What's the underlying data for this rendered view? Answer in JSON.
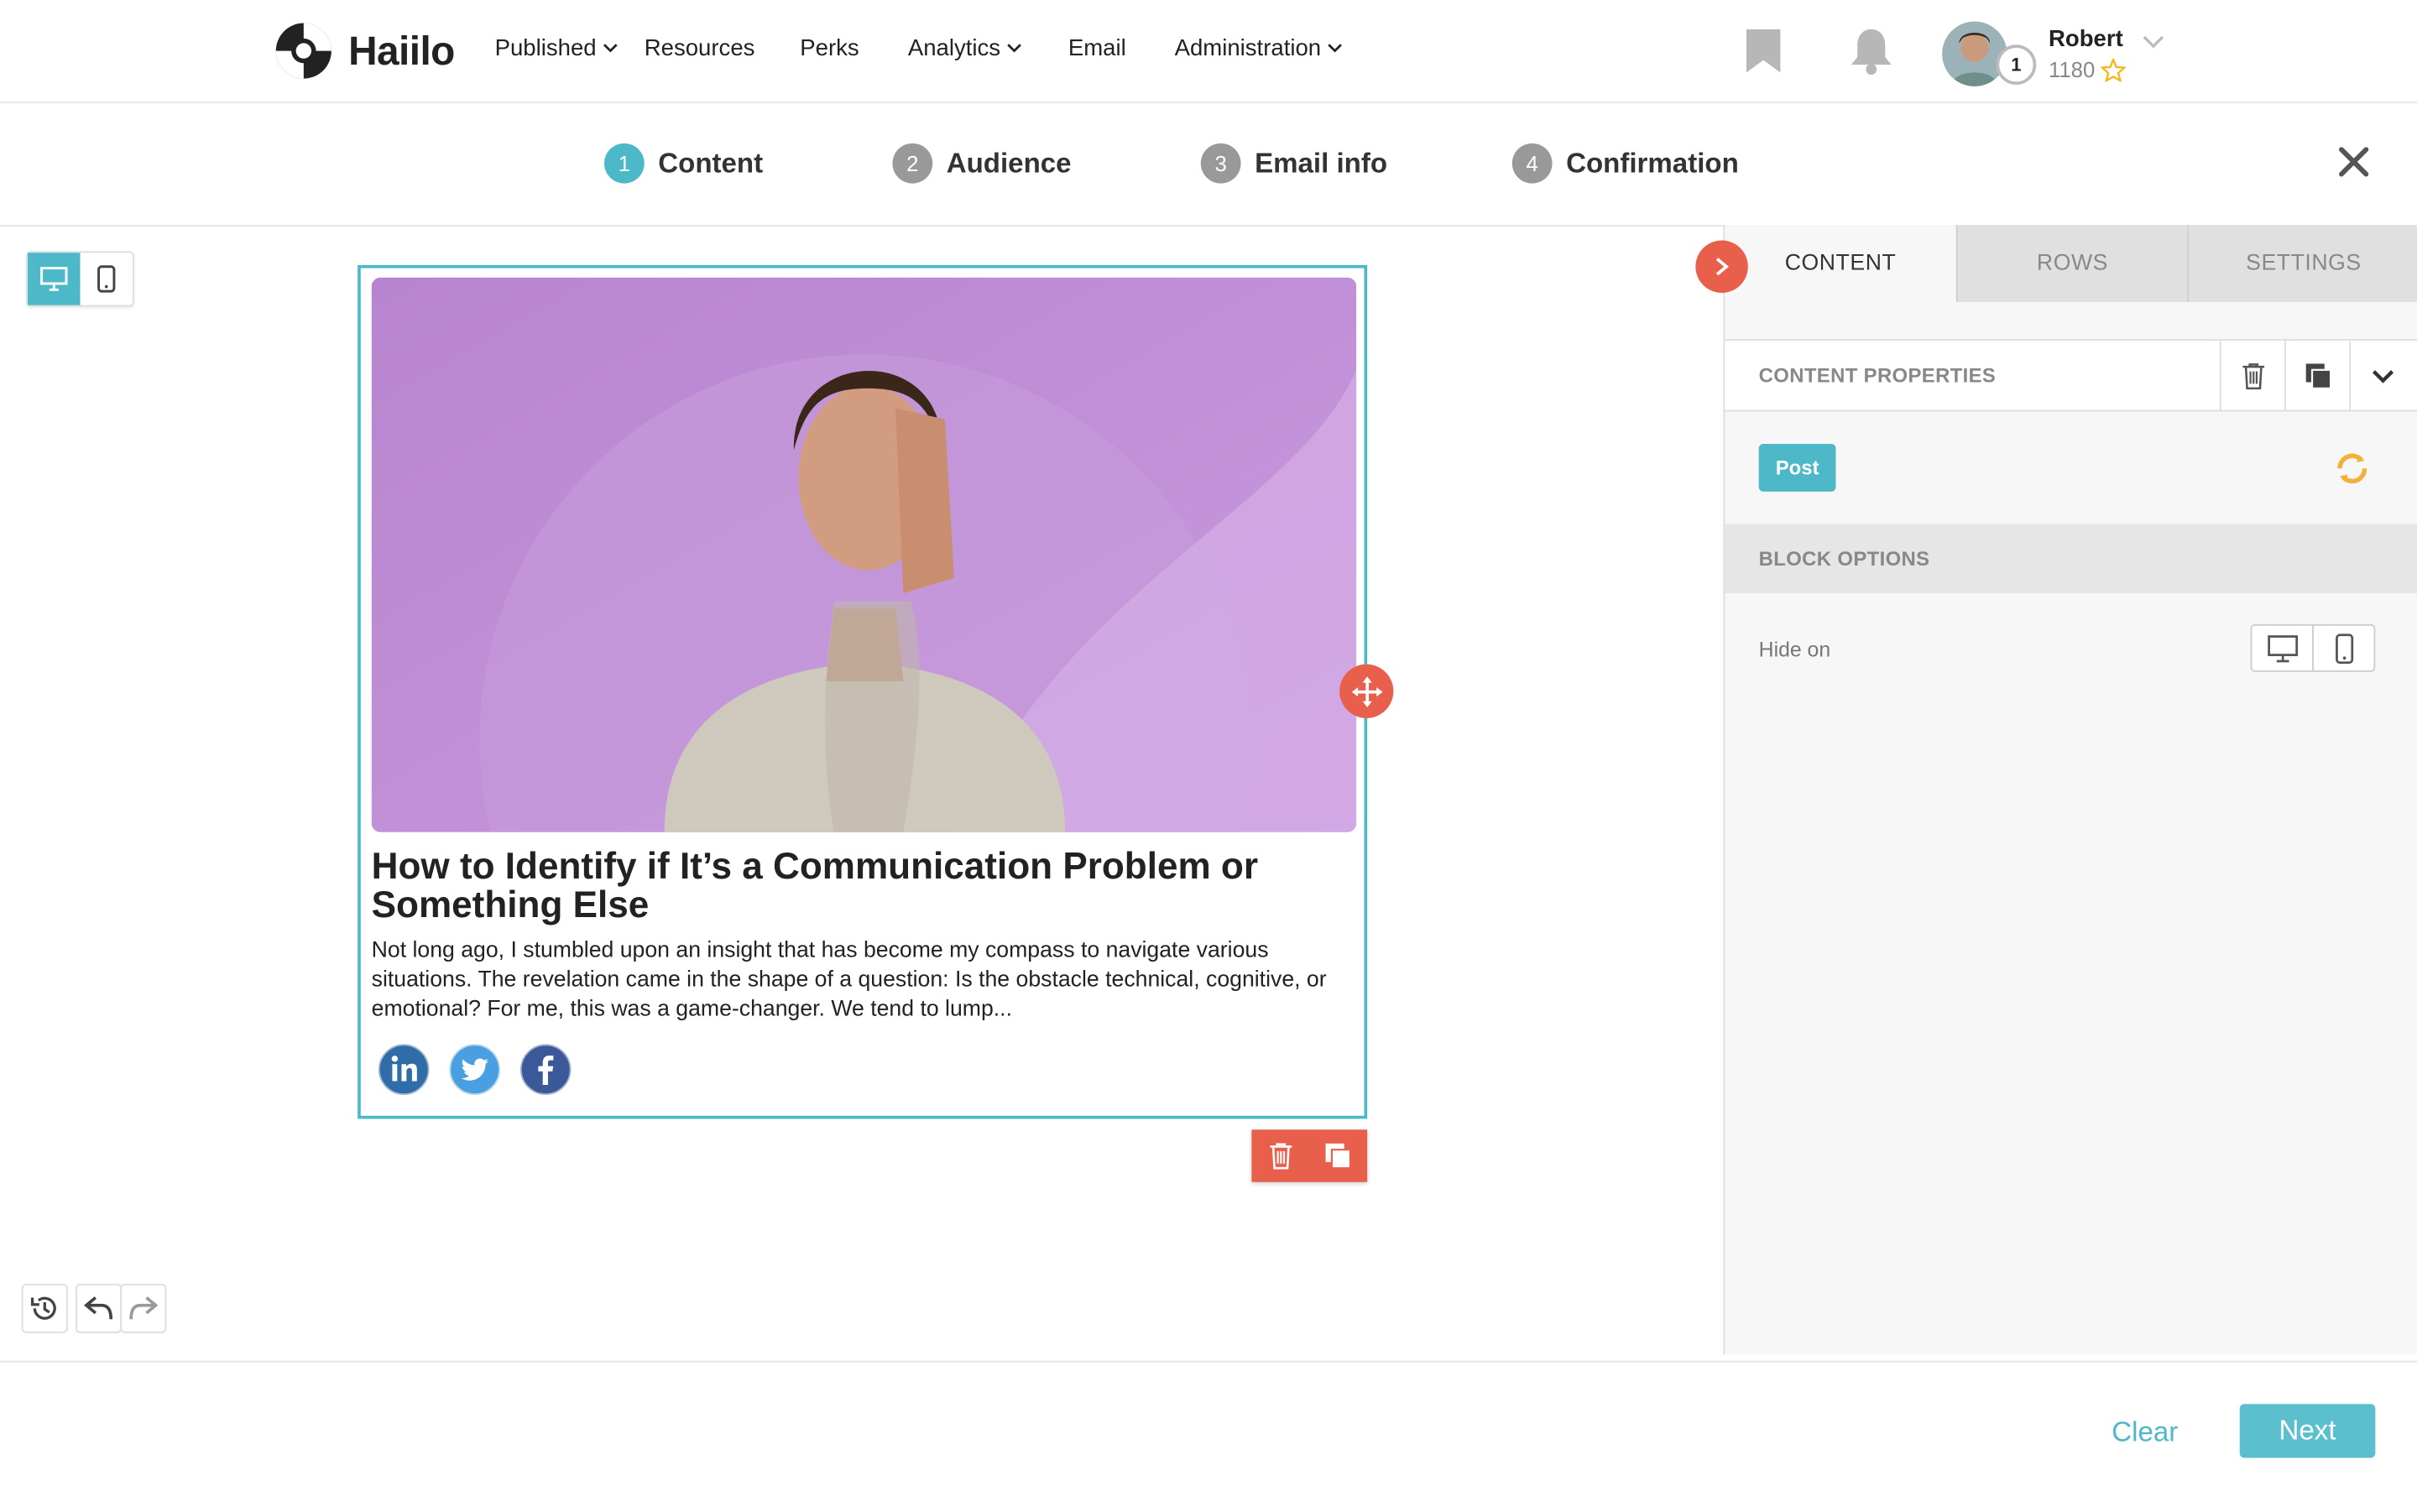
{
  "app": {
    "logo_text": "Haiilo"
  },
  "nav": {
    "items": [
      {
        "label": "Published",
        "has_dropdown": true
      },
      {
        "label": "Resources",
        "has_dropdown": false
      },
      {
        "label": "Perks",
        "has_dropdown": false
      },
      {
        "label": "Analytics",
        "has_dropdown": true
      },
      {
        "label": "Email",
        "has_dropdown": false
      },
      {
        "label": "Administration",
        "has_dropdown": true
      }
    ]
  },
  "user": {
    "name": "Robert",
    "points": "1180",
    "level_badge": "1"
  },
  "steps": [
    {
      "number": "1",
      "label": "Content",
      "active": true
    },
    {
      "number": "2",
      "label": "Audience",
      "active": false
    },
    {
      "number": "3",
      "label": "Email info",
      "active": false
    },
    {
      "number": "4",
      "label": "Confirmation",
      "active": false
    }
  ],
  "post": {
    "title": "How to Identify if It’s a Communication Problem or Something Else",
    "excerpt": "Not long ago, I stumbled upon an insight that has become my compass to navigate various situations. The revelation came in the shape of a question: Is the obstacle technical, cognitive, or emotional? For me, this was a game-changer. We tend to lump...",
    "social": [
      "linkedin-icon",
      "twitter-icon",
      "facebook-icon"
    ]
  },
  "panel": {
    "tabs": [
      {
        "label": "CONTENT",
        "active": true
      },
      {
        "label": "ROWS",
        "active": false
      },
      {
        "label": "SETTINGS",
        "active": false
      }
    ],
    "content_properties_title": "CONTENT PROPERTIES",
    "post_badge": "Post",
    "block_options_title": "BLOCK OPTIONS",
    "hide_on_label": "Hide on"
  },
  "footer": {
    "clear_label": "Clear",
    "next_label": "Next"
  },
  "colors": {
    "accent": "#4db8c8",
    "danger": "#e8604c",
    "hero_bg": "#c08ad6"
  }
}
